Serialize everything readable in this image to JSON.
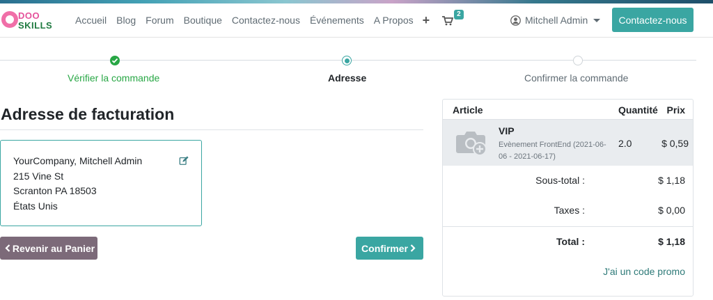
{
  "brand": {
    "line1": "DOO",
    "line2": "SKILLS",
    "colors": {
      "pink": "#f06fa8",
      "green": "#1f7a40"
    }
  },
  "nav": {
    "items": [
      "Accueil",
      "Blog",
      "Forum",
      "Boutique",
      "Contactez-nous",
      "Événements",
      "A Propos"
    ],
    "plus_icon": "+",
    "cart_count": "2",
    "user_name": "Mitchell Admin",
    "cta_label": "Contactez-nous"
  },
  "wizard": {
    "steps": [
      {
        "label": "Vérifier la commande",
        "state": "done"
      },
      {
        "label": "Adresse",
        "state": "active"
      },
      {
        "label": "Confirmer la commande",
        "state": "todo"
      }
    ]
  },
  "billing": {
    "title": "Adresse de facturation",
    "address_lines": [
      "YourCompany, Mitchell Admin",
      "215 Vine St",
      "Scranton PA 18503",
      "États Unis"
    ]
  },
  "actions": {
    "back_label": "Revenir au Panier",
    "confirm_label": "Confirmer"
  },
  "summary": {
    "headers": {
      "article": "Article",
      "quantity": "Quantité",
      "price": "Prix"
    },
    "product": {
      "name": "VIP",
      "description": "Evènement FrontEnd (2021-06-06 - 2021-06-17)",
      "quantity": "2.0",
      "price": "$ 0,59"
    },
    "subtotal": {
      "label": "Sous-total :",
      "value": "$ 1,18"
    },
    "taxes": {
      "label": "Taxes :",
      "value": "$ 0,00"
    },
    "total": {
      "label": "Total :",
      "value": "$ 1,18"
    },
    "promo_label": "J'ai un code promo"
  },
  "colors": {
    "accent": "#3aa6a2",
    "success": "#28a745",
    "back_button": "#7c6a79"
  }
}
